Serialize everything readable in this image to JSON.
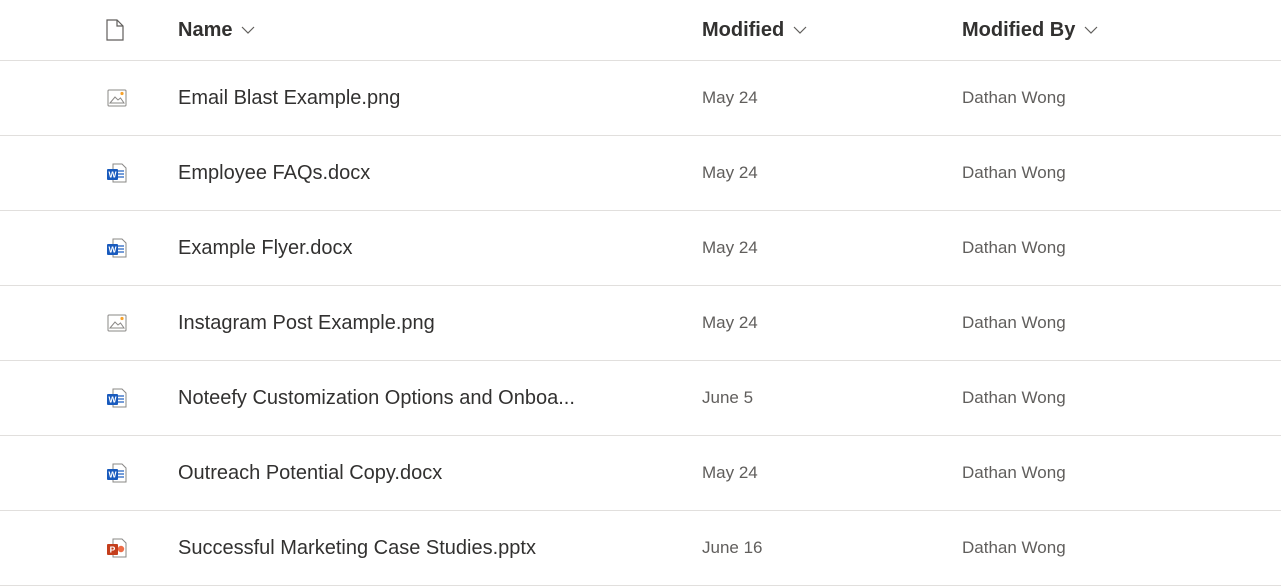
{
  "header": {
    "file_type_icon": "document-icon",
    "name_label": "Name",
    "modified_label": "Modified",
    "modified_by_label": "Modified By"
  },
  "rows": [
    {
      "icon": "image-file-icon",
      "name": "Email Blast Example.png",
      "modified": "May 24",
      "modified_by": "Dathan Wong"
    },
    {
      "icon": "word-file-icon",
      "name": "Employee FAQs.docx",
      "modified": "May 24",
      "modified_by": "Dathan Wong"
    },
    {
      "icon": "word-file-icon",
      "name": "Example Flyer.docx",
      "modified": "May 24",
      "modified_by": "Dathan Wong"
    },
    {
      "icon": "image-file-icon",
      "name": "Instagram Post Example.png",
      "modified": "May 24",
      "modified_by": "Dathan Wong"
    },
    {
      "icon": "word-file-icon",
      "name": "Noteefy Customization Options and Onboa...",
      "modified": "June 5",
      "modified_by": "Dathan Wong"
    },
    {
      "icon": "word-file-icon",
      "name": "Outreach Potential Copy.docx",
      "modified": "May 24",
      "modified_by": "Dathan Wong"
    },
    {
      "icon": "powerpoint-file-icon",
      "name": "Successful Marketing Case Studies.pptx",
      "modified": "June 16",
      "modified_by": "Dathan Wong"
    }
  ],
  "colors": {
    "word_blue": "#185abd",
    "powerpoint_red": "#c43e1c",
    "image_orange": "#f7a12a",
    "divider": "#e1dfdd"
  }
}
